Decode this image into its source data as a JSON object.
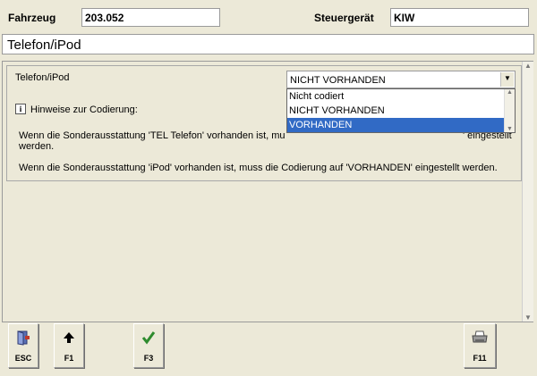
{
  "header": {
    "vehicle_label": "Fahrzeug",
    "vehicle_value": "203.052",
    "ecu_label": "Steuergerät",
    "ecu_value": "KIW"
  },
  "title": "Telefon/iPod",
  "setting": {
    "label": "Telefon/iPod",
    "selected": "NICHT VORHANDEN",
    "options": [
      "Nicht codiert",
      "NICHT VORHANDEN",
      "VORHANDEN"
    ],
    "highlighted_option": "VORHANDEN"
  },
  "info": {
    "title": "Hinweise zur Codierung:",
    "line1_left": "Wenn die Sonderausstattung 'TEL Telefon' vorhanden ist, mu",
    "line1_right": "' eingestellt",
    "line1_cont": "werden.",
    "line2": "Wenn die Sonderausstattung 'iPod' vorhanden ist, muss die Codierung auf 'VORHANDEN' eingestellt werden."
  },
  "fkeys": {
    "esc": "ESC",
    "f1": "F1",
    "f3": "F3",
    "f11": "F11"
  },
  "colors": {
    "background": "#ece9d8",
    "highlight": "#316ac5",
    "check_green": "#2e8b2e"
  },
  "icons": {
    "esc": "exit-door-icon",
    "f1": "arrow-up-icon",
    "f3": "checkmark-icon",
    "f11": "printer-icon"
  }
}
